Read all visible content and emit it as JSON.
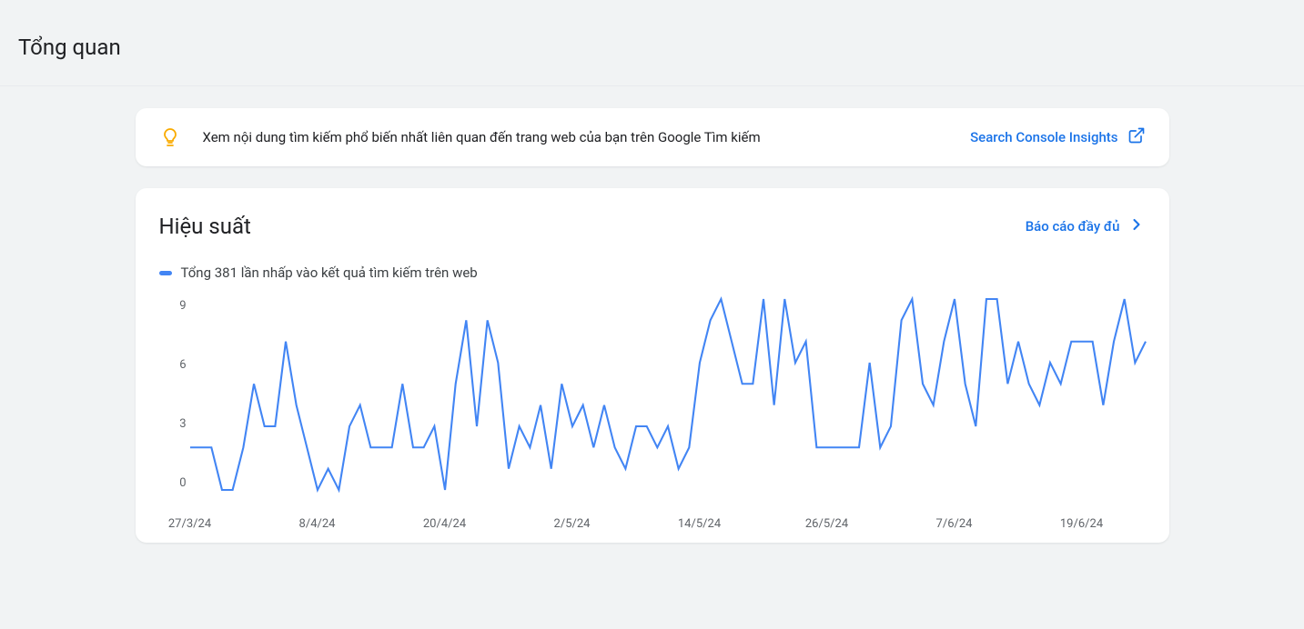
{
  "header": {
    "title": "Tổng quan"
  },
  "insights": {
    "text": "Xem nội dung tìm kiếm phổ biến nhất liên quan đến trang web của bạn trên Google Tìm kiếm",
    "link_label": "Search Console Insights"
  },
  "performance": {
    "title": "Hiệu suất",
    "full_report_label": "Báo cáo đầy đủ",
    "legend_label": "Tổng 381 lần nhấp vào kết quả tìm kiếm trên web"
  },
  "chart_data": {
    "type": "line",
    "title": "",
    "xlabel": "",
    "ylabel": "",
    "ylim": [
      0,
      9
    ],
    "y_ticks": [
      0,
      3,
      6,
      9
    ],
    "x_tick_labels": [
      "27/3/24",
      "8/4/24",
      "20/4/24",
      "2/5/24",
      "14/5/24",
      "26/5/24",
      "7/6/24",
      "19/6/24"
    ],
    "x_tick_positions": [
      0,
      12,
      24,
      36,
      48,
      60,
      72,
      84
    ],
    "series": [
      {
        "name": "Clicks",
        "color": "#4285f4",
        "values": [
          2,
          2,
          2,
          0,
          0,
          2,
          5,
          3,
          3,
          7,
          4,
          2,
          0,
          1,
          0,
          3,
          4,
          2,
          2,
          2,
          5,
          2,
          2,
          3,
          0,
          5,
          8,
          3,
          8,
          6,
          1,
          3,
          2,
          4,
          1,
          5,
          3,
          4,
          2,
          4,
          2,
          1,
          3,
          3,
          2,
          3,
          1,
          2,
          6,
          8,
          9,
          7,
          5,
          5,
          9,
          4,
          9,
          6,
          7,
          2,
          2,
          2,
          2,
          2,
          6,
          2,
          3,
          8,
          9,
          5,
          4,
          7,
          9,
          5,
          3,
          9,
          9,
          5,
          7,
          5,
          4,
          6,
          5,
          7,
          7,
          7,
          4,
          7,
          9,
          6,
          7
        ]
      }
    ]
  }
}
